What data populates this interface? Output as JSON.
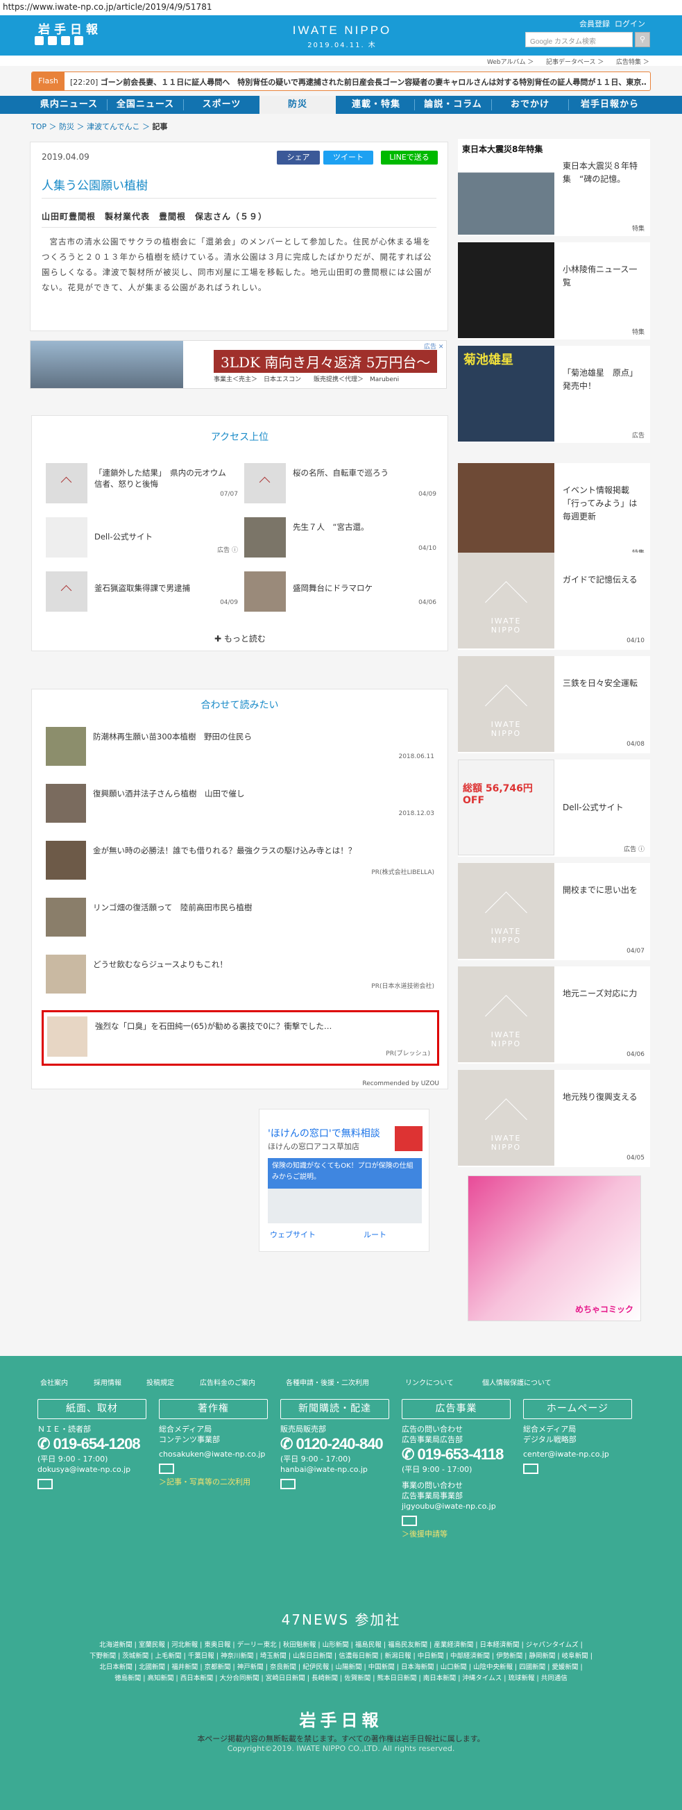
{
  "url": "https://www.iwate-np.co.jp/article/2019/4/9/51781",
  "header": {
    "logo": "岩手日報",
    "site_title": "IWATE NIPPO",
    "date": "2019.04.11. 木",
    "member_register": "会員登録",
    "login": "ログイン",
    "search_placeholder": "Google カスタム検索",
    "sublinks": [
      "Webアルバム ＞",
      "記事データベース ＞",
      "広告特集 ＞"
    ]
  },
  "flash": {
    "label": "Flash",
    "time": "[22:20]",
    "text": "ゴーン前会長妻、１１日に証人尋問へ　特別背任の疑いで再逮捕された前日産会長ゴーン容疑者の妻キャロルさんは対する特別背任の証人尋問が１１日、東京…"
  },
  "nav": [
    "県内ニュース",
    "全国ニュース",
    "スポーツ",
    "防災",
    "連載・特集",
    "論説・コラム",
    "おでかけ",
    "岩手日報から"
  ],
  "breadcrumb": {
    "top": "TOP",
    "sep": "＞",
    "c1": "防災",
    "c2": "津波てんでんこ",
    "current": "記事"
  },
  "article": {
    "date": "2019.04.09",
    "share_fb": "シェア",
    "share_tw": "ツイート",
    "share_line": "LINEで送る",
    "title": "人集う公園願い植樹",
    "subtitle": "山田町豊間根　製材業代表　豊間根　保志さん（５９）",
    "body": "宮古市の清水公園でサクラの植樹会に「還弟会」のメンバーとして参加した。住民が心休まる場をつくろうと２０１３年から植樹を続けている。清水公園は３月に完成したばかりだが、開花すれば公園らしくなる。津波で製材所が被災し、同市刈屋に工場を移転した。地元山田町の豊間根には公園がない。花見ができて、人が集まる公園があればうれしい。"
  },
  "ad1": {
    "headline": "3LDK 南向き月々返済 5万円台～",
    "sub": "事業主＜売主＞　日本エスコン　　販売提携＜代理＞　Marubeni",
    "choice": "広告 ✕"
  },
  "ranking": {
    "title": "アクセス上位",
    "items": [
      {
        "title": "「連鎖外した結果」　県内の元オウム信者、怒りと後悔",
        "date": "07/07"
      },
      {
        "title": "桜の名所、自転車で巡ろう",
        "date": "04/09"
      },
      {
        "title": "Dell-公式サイト",
        "date": "広告 ⓘ"
      },
      {
        "title": "先生７人　“宮古還。",
        "date": "04/10"
      },
      {
        "title": "釜石猟盗取集得課で男逮捕",
        "date": "04/09"
      },
      {
        "title": "盛岡舞台にドラマロケ",
        "date": "04/06"
      }
    ],
    "more": "もっと読む"
  },
  "related": {
    "title": "合わせて読みたい",
    "items": [
      {
        "title": "防潮林再生願い苗300本植樹　野田の住民ら",
        "date": "2018.06.11"
      },
      {
        "title": "復興願い酒井法子さんら植樹　山田で催し",
        "date": "2018.12.03"
      },
      {
        "title": "金が無い時の必勝法！誰でも借りれる？最強クラスの駆け込み寺とは！？",
        "date": "PR(株式会社LIBELLA)"
      },
      {
        "title": "リンゴ畑の復活願って　陸前高田市民ら植樹",
        "date": ""
      },
      {
        "title": "どうせ飲むならジュースよりもこれ！",
        "date": "PR(日本水道技術会社)"
      },
      {
        "title": "強烈な「口臭」を石田純一(65)が勧める裏技で0に？衝撃でした…",
        "date": "PR(ブレッシュ)"
      }
    ],
    "recommended": "Recommended by UZOU"
  },
  "ad2": {
    "title": "'ほけんの窓口'で無料相談",
    "sub": "ほけんの窓口アコス草加店",
    "banner": "保険の知識がなくてもOK！プロが保険の仕組みからご説明。",
    "website": "ウェブサイト",
    "route": "ルート"
  },
  "sidebar": [
    {
      "title": "東日本大震災８年特集　“碑の記憶。",
      "tag": "特集"
    },
    {
      "title": "小林陵侑ニュース一覧",
      "tag": "特集"
    },
    {
      "title": "「菊池雄星　原点」発売中！",
      "tag": "広告"
    },
    {
      "title": "イベント情報掲載「行ってみよう」は毎週更新",
      "tag": "特集"
    },
    {
      "title": "ガイドで記憶伝える",
      "tag": "04/10"
    },
    {
      "title": "三鉄を日々安全運転",
      "tag": "04/08"
    },
    {
      "title": "Dell-公式サイト",
      "tag": "広告 ⓘ"
    },
    {
      "title": "開校までに思い出を",
      "tag": "04/07"
    },
    {
      "title": "地元ニーズ対応に力",
      "tag": "04/06"
    },
    {
      "title": "地元残り復興支える",
      "tag": "04/05"
    }
  ],
  "sidebar_extra": {
    "yusei": "菊池雄星",
    "tohoku": "東日本大震災8年特集",
    "dell_price": "総額 56,746円OFF",
    "comic": "めちゃコミック"
  },
  "footer": {
    "links": [
      "会社案内",
      "採用情報",
      "投稿規定",
      "広告料金のご案内",
      "各種申請・後援・二次利用",
      "リンクについて",
      "個人情報保護について"
    ],
    "boxes": [
      "紙面、取材",
      "著作権",
      "新聞購読・配達",
      "広告事業",
      "ホームページ"
    ],
    "cols": [
      {
        "l1": "ＮＩＥ・読者部",
        "l2": "",
        "tel": "019-654-1208",
        "hours": "(平日 9:00 - 17:00)",
        "mail": "dokusya@iwate-np.co.jp",
        "extra": ""
      },
      {
        "l1": "総合メディア局",
        "l2": "コンテンツ事業部",
        "tel": "",
        "hours": "",
        "mail": "chosakuken@iwate-np.co.jp",
        "extra": "＞記事・写真等の二次利用"
      },
      {
        "l1": "販売局販売部",
        "l2": "",
        "tel": "0120-240-840",
        "hours": "(平日 9:00 - 17:00)",
        "mail": "hanbai@iwate-np.co.jp",
        "extra": ""
      },
      {
        "l1": "広告の問い合わせ",
        "l2": "広告事業局広告部",
        "tel": "019-653-4118",
        "hours": "(平日 9:00 - 17:00)",
        "mail": "jigyoubu@iwate-np.co.jp",
        "extra": "＞後援申請等",
        "l3": "事業の問い合わせ",
        "l4": "広告事業局事業部"
      },
      {
        "l1": "総合メディア局",
        "l2": "デジタル戦略部",
        "tel": "",
        "hours": "",
        "mail": "center@iwate-np.co.jp",
        "extra": ""
      }
    ],
    "news47": "47NEWS 参加社",
    "papers": [
      "北海道新聞 | 室蘭民報 | 河北新報 | 東奥日報 | デーリー東北 | 秋田魁新報 | 山形新聞 | 福島民報 | 福島民友新聞 | 産業経済新聞 | 日本経済新聞 | ジャパンタイムズ |",
      "下野新聞 | 茨城新聞 | 上毛新聞 | 千葉日報 | 神奈川新聞 | 埼玉新聞 | 山梨日日新聞 | 信濃毎日新聞 | 新潟日報 | 中日新聞 | 中部経済新聞 | 伊勢新聞 | 静岡新聞 | 岐阜新聞 |",
      "北日本新聞 | 北國新聞 | 福井新聞 | 京都新聞 | 神戸新聞 | 奈良新聞 | 紀伊民報 | 山陽新聞 | 中国新聞 | 日本海新聞 | 山口新聞 | 山陰中央新報 | 四國新聞 | 愛媛新聞 |",
      "徳島新聞 | 高知新聞 | 西日本新聞 | 大分合同新聞 | 宮崎日日新聞 | 長崎新聞 | 佐賀新聞 | 熊本日日新聞 | 南日本新聞 | 沖縄タイムス | 琉球新報 | 共同通信"
    ],
    "logo": "岩手日報",
    "copy1": "本ページ掲載内容の無断転載を禁じます。すべての著作権は岩手日報社に属します。",
    "copy2": "Copyright©2019. IWATE NIPPO CO.,LTD. All rights reserved."
  }
}
